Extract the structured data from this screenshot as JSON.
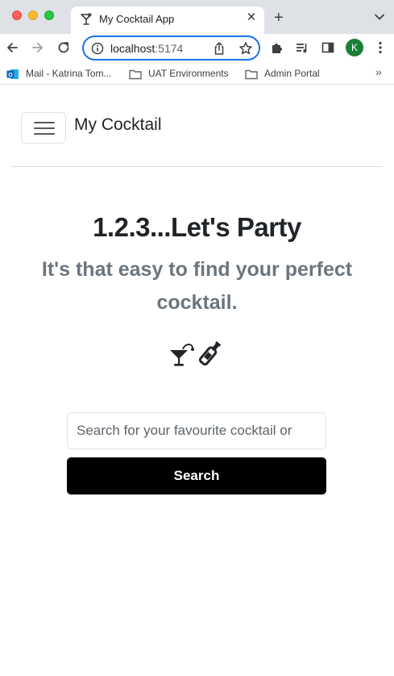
{
  "browser": {
    "tab": {
      "title": "My Cocktail App",
      "favicon": "cocktail-glass-icon"
    },
    "toolbar": {
      "url_host": "localhost",
      "url_port": ":5174",
      "profile_initial": "K",
      "profile_color": "#188038",
      "accent_color": "#1a73e8"
    },
    "bookmarks": [
      {
        "label": "Mail - Katrina Tom...",
        "icon": "outlook-icon"
      },
      {
        "label": "UAT Environments",
        "icon": "folder-icon"
      },
      {
        "label": "Admin Portal",
        "icon": "folder-icon"
      }
    ]
  },
  "page": {
    "navbar": {
      "brand": "My Cocktail",
      "toggle_icon": "hamburger-menu-icon"
    },
    "hero": {
      "title": "1.2.3...Let's Party",
      "subtitle": "It's that easy to find your perfect cocktail.",
      "icon": "cocktail-and-bottle-icon"
    },
    "search": {
      "placeholder": "Search for your favourite cocktail or",
      "value": "",
      "button_label": "Search",
      "button_color": "#000000"
    }
  }
}
